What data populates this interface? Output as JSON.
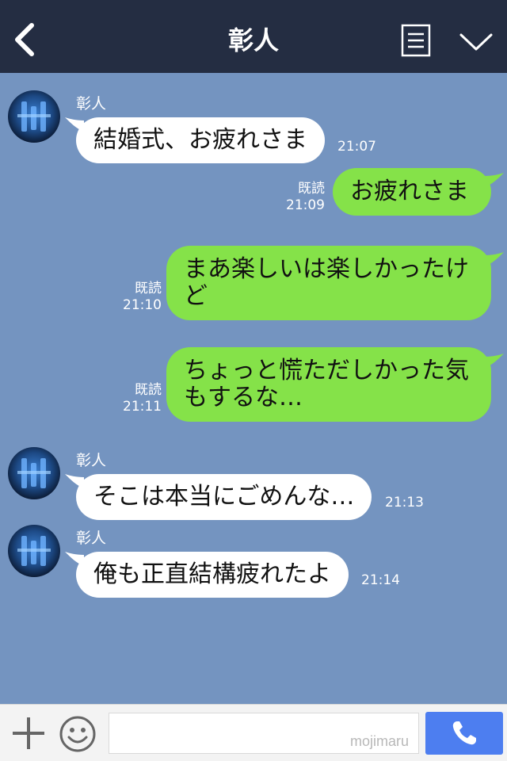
{
  "header": {
    "title": "彰人"
  },
  "messages": [
    {
      "sender": "彰人",
      "text": "結婚式、お疲れさま",
      "time": "21:07"
    },
    {
      "read": "既読",
      "time": "21:09",
      "text": "お疲れさま"
    },
    {
      "read": "既読",
      "time": "21:10",
      "text_line1": "まあ楽しいは楽しかったけ",
      "text_line2": "ど"
    },
    {
      "read": "既読",
      "time": "21:11",
      "text_line1": "ちょっと慌ただしかった気",
      "text_line2": "もするな…"
    },
    {
      "sender": "彰人",
      "text": "そこは本当にごめんな…",
      "time": "21:13"
    },
    {
      "sender": "彰人",
      "text": "俺も正直結構疲れたよ",
      "time": "21:14"
    }
  ],
  "footer": {
    "watermark": "mojimaru"
  },
  "icons": {
    "back": "chevron-left-icon",
    "menu": "note-icon",
    "collapse": "chevron-down-icon",
    "add": "plus-icon",
    "emoji": "smiley-icon",
    "call": "phone-icon"
  },
  "colors": {
    "header": "#242d42",
    "background": "#7494c0",
    "incoming_bubble": "#ffffff",
    "outgoing_bubble": "#85e249",
    "call_button": "#4d7ef0"
  }
}
